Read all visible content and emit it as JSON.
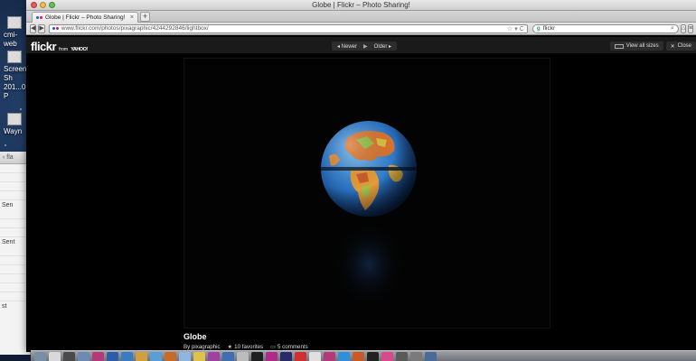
{
  "window": {
    "title": "Globe | Flickr – Photo Sharing!"
  },
  "tab": {
    "label": "Globe | Flickr – Photo Sharing!",
    "close": "×",
    "new_tab": "+"
  },
  "nav": {
    "back": "◀",
    "forward": "▶",
    "url": "www.flickr.com/photos/pixagraphic/4244292846/lightbox/",
    "url_tail": "☆ ▾ C",
    "search_engine": "g",
    "search_value": "flickr",
    "home": "⌂",
    "menu": "≡"
  },
  "flickr": {
    "logo": "flickr",
    "logo_from": "from",
    "logo_yahoo": "YAHOO!",
    "pager": {
      "newer": "◂ Newer",
      "play": "▶",
      "older": "Older ▸"
    },
    "view_all_sizes": "View all sizes",
    "close": "Close"
  },
  "photo": {
    "title": "Globe",
    "by": "By pixagraphic",
    "favorites": "10 favorites",
    "comments": "5 comments"
  },
  "desktop": {
    "icon1_label": "cmi- web",
    "icon2_label": "Screen Sh 201...0 P",
    "icon3_label": "Wayn"
  },
  "bg_window": {
    "bar_text": "‹ fla",
    "row_label_1": "Sen",
    "row_label_2": "Sent",
    "bottom_label": "st"
  }
}
